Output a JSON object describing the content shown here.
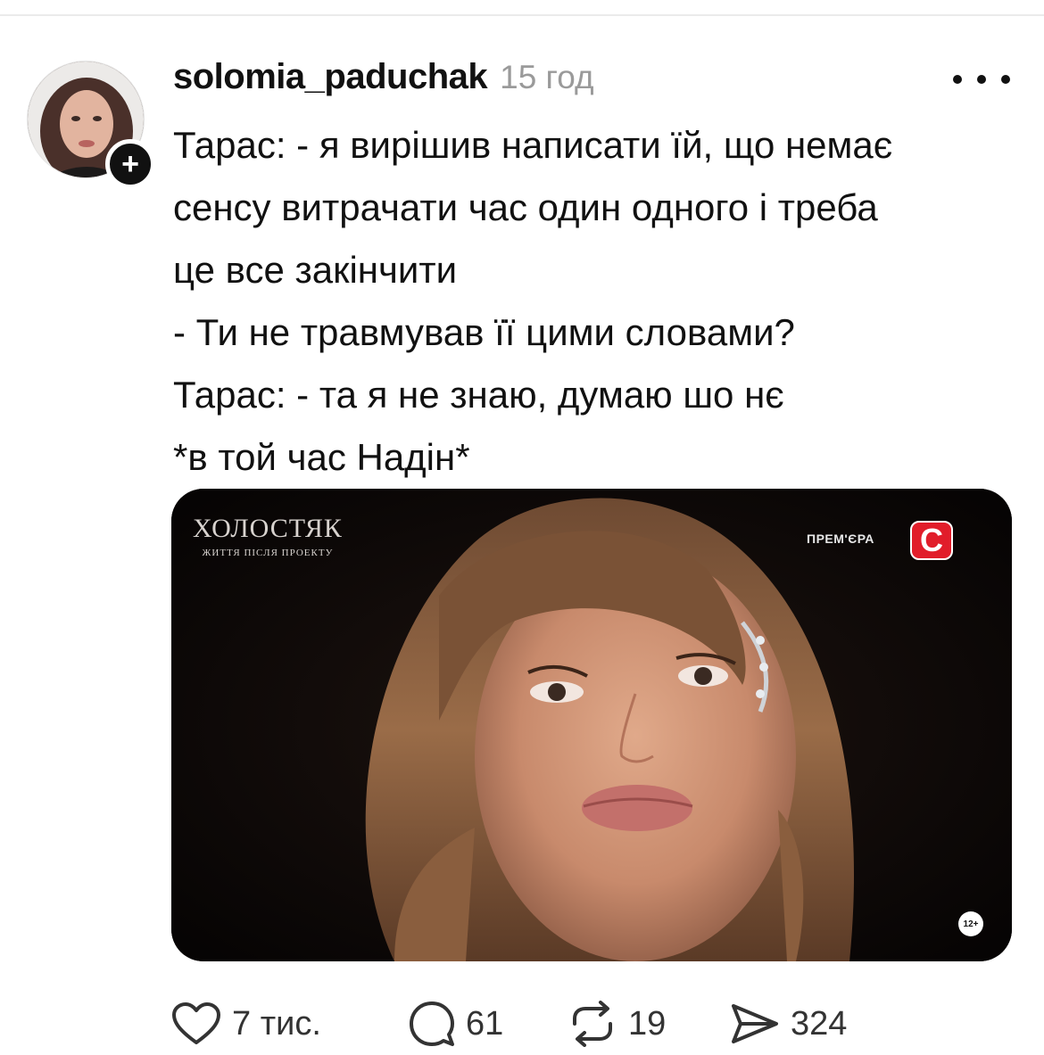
{
  "post": {
    "username": "solomia_paduchak",
    "timestamp": "15 год",
    "lines": [
      "Тарас: - я вирішив написати їй, що немає",
      "сенсу витрачати час один одного і треба",
      "це все закінчити",
      "- Ти не травмував її цими словами?",
      "Тарас: - та я не знаю, думаю шо нє",
      "*в той час Надін*"
    ],
    "follow_symbol": "+"
  },
  "media": {
    "show_title": "ХОЛОСТЯК",
    "show_subtitle": "ЖИТТЯ ПІСЛЯ ПРОЕКТУ",
    "premiere": "ПРЕМ'ЄРА",
    "channel": "С",
    "age_rating": "12+"
  },
  "actions": {
    "likes": "7 тис.",
    "comments": "61",
    "reposts": "19",
    "shares": "324"
  },
  "icons": {
    "like": "heart-icon",
    "comment": "comment-bubble-icon",
    "repost": "repost-icon",
    "share": "send-icon",
    "more": "more-dots-icon"
  }
}
